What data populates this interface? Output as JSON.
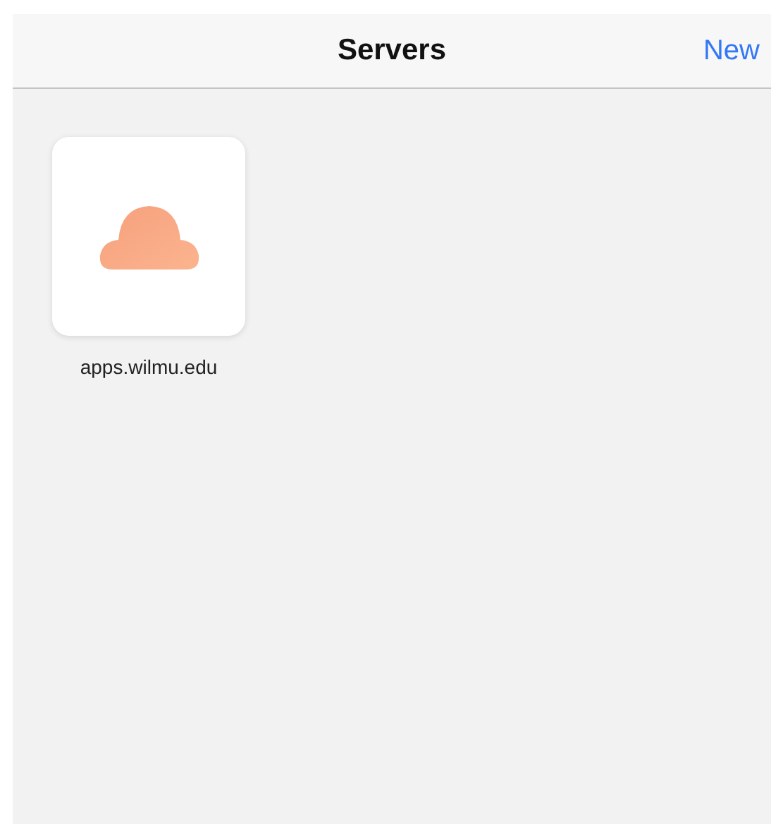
{
  "navigation_bar": {
    "title": "Servers",
    "action": "New"
  },
  "servers": [
    {
      "name": "apps.wilmu.edu"
    }
  ]
}
